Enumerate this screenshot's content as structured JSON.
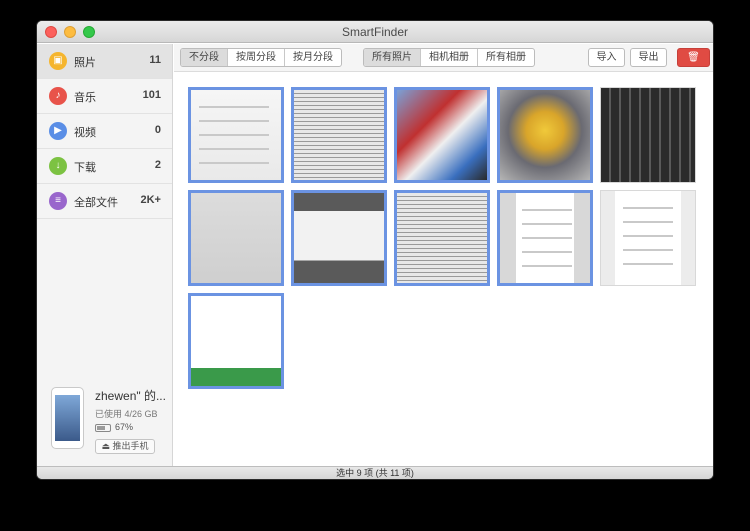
{
  "window": {
    "title": "SmartFinder"
  },
  "sidebar": {
    "items": [
      {
        "label": "照片",
        "count": "11",
        "color": "#f5b52e",
        "icon": "photo-icon",
        "glyph": "▣"
      },
      {
        "label": "音乐",
        "count": "101",
        "color": "#e8534a",
        "icon": "music-icon",
        "glyph": "♪"
      },
      {
        "label": "视频",
        "count": "0",
        "color": "#5a8ee6",
        "icon": "video-icon",
        "glyph": "▶"
      },
      {
        "label": "下载",
        "count": "2",
        "color": "#7cc242",
        "icon": "download-icon",
        "glyph": "↓"
      },
      {
        "label": "全部文件",
        "count": "2K+",
        "color": "#9966cc",
        "icon": "files-icon",
        "glyph": "≡"
      }
    ]
  },
  "device": {
    "name": "zhewen\" 的...",
    "usage": "已使用 4/26 GB",
    "battery": "67%",
    "battery_level": 0.67,
    "eject_label": "推出手机"
  },
  "toolbar": {
    "group_by": [
      "不分段",
      "按周分段",
      "按月分段"
    ],
    "group_by_selected": 0,
    "albums": [
      "所有照片",
      "相机相册",
      "所有相册"
    ],
    "albums_selected": 0,
    "import_label": "导入",
    "export_label": "导出",
    "delete_icon": "trash-icon"
  },
  "photos": [
    {
      "id": "photo-1",
      "selected": true,
      "style": "settings"
    },
    {
      "id": "photo-2",
      "selected": true,
      "style": "document"
    },
    {
      "id": "photo-3",
      "selected": true,
      "style": "toys"
    },
    {
      "id": "photo-4",
      "selected": true,
      "style": "minion"
    },
    {
      "id": "photo-5",
      "selected": false,
      "style": "keyboard"
    },
    {
      "id": "photo-6",
      "selected": true,
      "style": "gray-settings"
    },
    {
      "id": "photo-7",
      "selected": true,
      "style": "usb-dialog"
    },
    {
      "id": "photo-8",
      "selected": true,
      "style": "document"
    },
    {
      "id": "photo-9",
      "selected": true,
      "style": "screenshot"
    },
    {
      "id": "photo-10",
      "selected": false,
      "style": "screenshot-gray"
    },
    {
      "id": "photo-11",
      "selected": true,
      "style": "app-splash"
    }
  ],
  "status": {
    "text": "选中 9 项 (共 11 项)"
  }
}
